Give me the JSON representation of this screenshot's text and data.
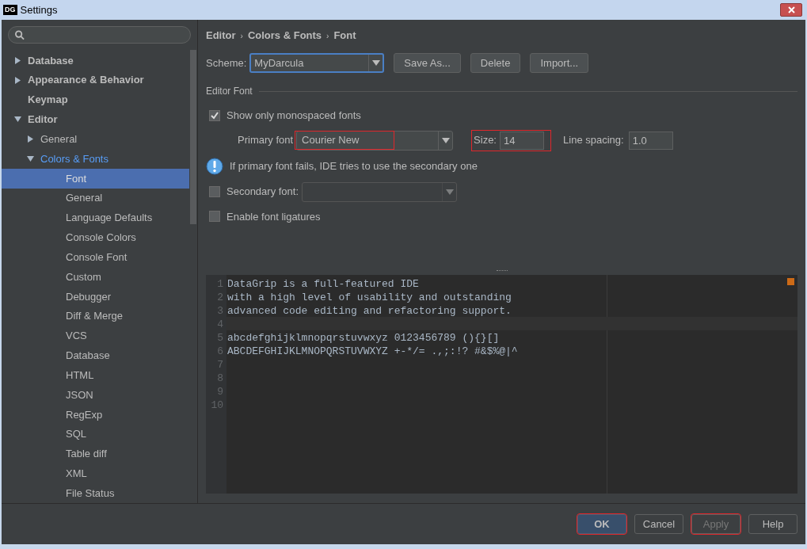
{
  "window": {
    "title": "Settings",
    "app_badge": "DG"
  },
  "sidebar": {
    "tree": [
      {
        "label": "Database",
        "expanded": false,
        "selected": false
      },
      {
        "label": "Appearance & Behavior",
        "expanded": false,
        "selected": false
      },
      {
        "label": "Keymap",
        "selected": false
      },
      {
        "label": "Editor",
        "expanded": true,
        "selected": false,
        "children": [
          {
            "label": "General",
            "expanded": false,
            "selected": false
          },
          {
            "label": "Colors & Fonts",
            "expanded": true,
            "selected": false,
            "children": [
              {
                "label": "Font",
                "selected": true
              },
              {
                "label": "General",
                "selected": false
              },
              {
                "label": "Language Defaults",
                "selected": false
              },
              {
                "label": "Console Colors",
                "selected": false
              },
              {
                "label": "Console Font",
                "selected": false
              },
              {
                "label": "Custom",
                "selected": false
              },
              {
                "label": "Debugger",
                "selected": false
              },
              {
                "label": "Diff & Merge",
                "selected": false
              },
              {
                "label": "VCS",
                "selected": false
              },
              {
                "label": "Database",
                "selected": false
              },
              {
                "label": "HTML",
                "selected": false
              },
              {
                "label": "JSON",
                "selected": false
              },
              {
                "label": "RegExp",
                "selected": false
              },
              {
                "label": "SQL",
                "selected": false
              },
              {
                "label": "Table diff",
                "selected": false
              },
              {
                "label": "XML",
                "selected": false
              },
              {
                "label": "File Status",
                "selected": false
              }
            ]
          }
        ]
      }
    ]
  },
  "breadcrumb": {
    "separator": "›",
    "items": [
      "Editor",
      "Colors & Fonts",
      "Font"
    ]
  },
  "scheme": {
    "label": "Scheme:",
    "value": "MyDarcula",
    "buttons": [
      "Save As...",
      "Delete",
      "Import..."
    ]
  },
  "editor_font": {
    "title": "Editor Font",
    "show_mono": {
      "label": "Show only monospaced fonts",
      "checked": true
    },
    "primary": {
      "label": "Primary font",
      "value": "Courier New",
      "highlighted": true
    },
    "size": {
      "label": "Size:",
      "value": "14",
      "highlighted": true
    },
    "line_spacing": {
      "label": "Line spacing:",
      "value": "1.0"
    },
    "info": "If primary font fails, IDE tries to use the secondary one",
    "secondary": {
      "label": "Secondary font:",
      "checked": false
    },
    "ligatures": {
      "label": "Enable font ligatures",
      "checked": false
    }
  },
  "preview": {
    "lines": [
      {
        "number": "1",
        "text": "DataGrip is a full-featured IDE"
      },
      {
        "number": "2",
        "text": "with a high level of usability and outstanding"
      },
      {
        "number": "3",
        "text": "advanced code editing and refactoring support."
      },
      {
        "number": "4",
        "current": true
      },
      {
        "number": "5",
        "text": "abcdefghijklmnopqrstuvwxyz 0123456789 (){}[]"
      },
      {
        "number": "6",
        "text": "ABCDEFGHIJKLMNOPQRSTUVWXYZ +-*/= .,;:!? #&$%@|^"
      },
      {
        "number": "7"
      },
      {
        "number": "8"
      },
      {
        "number": "9"
      },
      {
        "number": "10"
      }
    ]
  },
  "footer": {
    "buttons": [
      {
        "label": "OK",
        "kind": "default",
        "disabled": false,
        "highlighted": true
      },
      {
        "label": "Cancel",
        "kind": "normal",
        "disabled": false,
        "highlighted": false
      },
      {
        "label": "Apply",
        "kind": "normal",
        "disabled": true,
        "highlighted": true
      },
      {
        "label": "Help",
        "kind": "normal",
        "disabled": false,
        "highlighted": false
      }
    ]
  }
}
